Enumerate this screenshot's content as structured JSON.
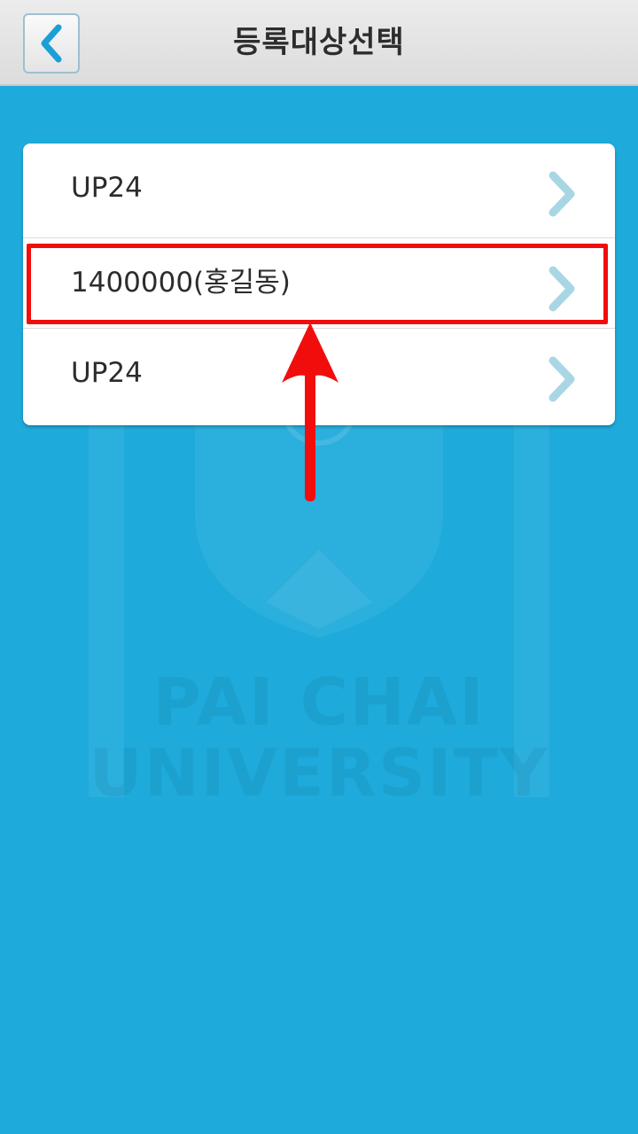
{
  "header": {
    "title": "등록대상선택",
    "back_icon": "chevron-left-icon"
  },
  "watermark": {
    "line1": "PAI CHAI",
    "line2": "UNIVERSITY"
  },
  "list": {
    "items": [
      {
        "label": "UP24",
        "icon": "chevron-right-icon"
      },
      {
        "label": "1400000(홍길동)",
        "icon": "chevron-right-icon"
      },
      {
        "label": "UP24",
        "icon": "chevron-right-icon"
      }
    ]
  },
  "colors": {
    "background": "#1eaadb",
    "header": "#e4e4e4",
    "accent": "#1b9fd6",
    "annotation": "#f20d0d",
    "chevron": "#a9d6e4"
  }
}
